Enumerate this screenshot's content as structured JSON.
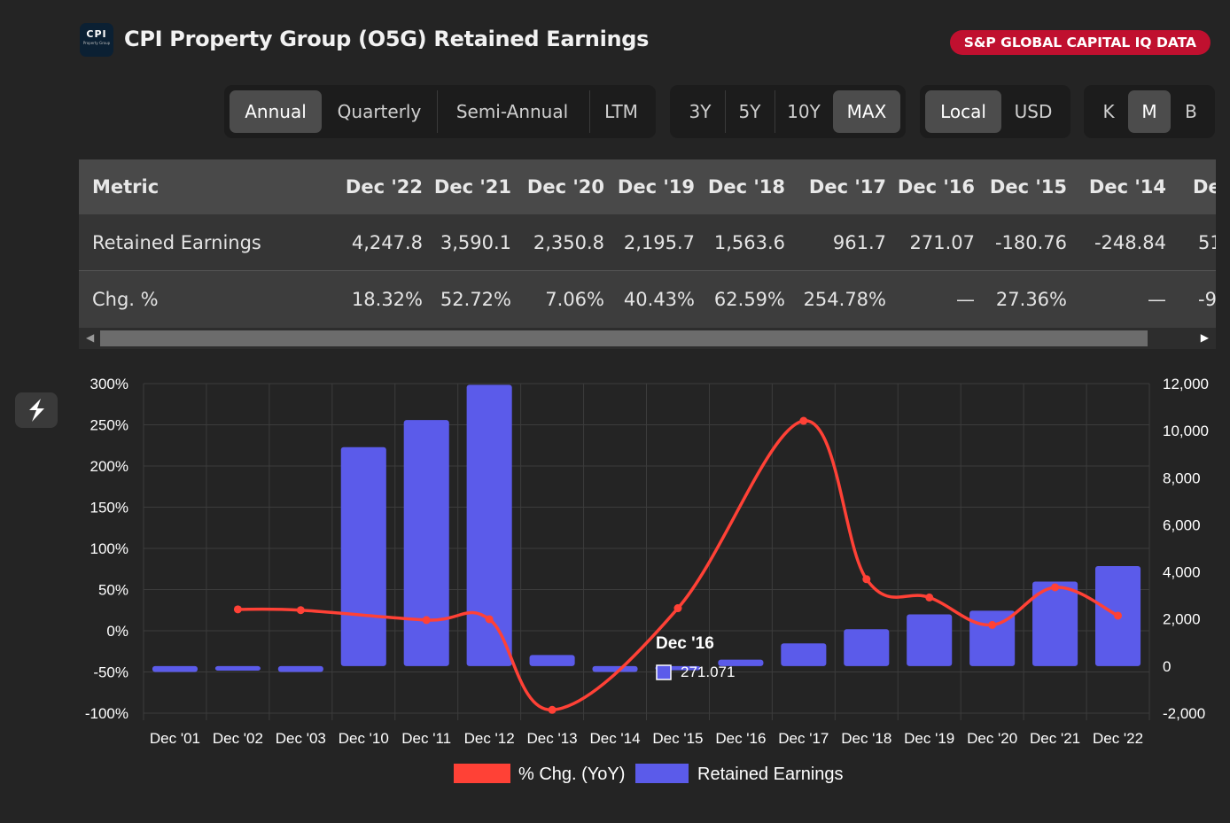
{
  "header": {
    "logo_text": "CPI",
    "logo_sub": "Property Group",
    "title": "CPI Property Group (O5G) Retained Earnings",
    "badge": "S&P GLOBAL CAPITAL IQ DATA"
  },
  "controls": {
    "period": [
      "Annual",
      "Quarterly",
      "Semi-Annual",
      "LTM"
    ],
    "period_active": "Annual",
    "range": [
      "3Y",
      "5Y",
      "10Y",
      "MAX"
    ],
    "range_active": "MAX",
    "currency": [
      "Local",
      "USD"
    ],
    "currency_active": "Local",
    "units": [
      "K",
      "M",
      "B"
    ],
    "units_active": "M"
  },
  "table": {
    "metric_header": "Metric",
    "columns": [
      "Dec '22",
      "Dec '21",
      "Dec '20",
      "Dec '19",
      "Dec '18",
      "Dec '17",
      "Dec '16",
      "Dec '15",
      "Dec '14",
      "De"
    ],
    "rows": [
      {
        "label": "Retained Earnings",
        "values": [
          "4,247.8",
          "3,590.1",
          "2,350.8",
          "2,195.7",
          "1,563.6",
          "961.7",
          "271.07",
          "-180.76",
          "-248.84",
          "51"
        ]
      },
      {
        "label": "Chg. %",
        "values": [
          "18.32%",
          "52.72%",
          "7.06%",
          "40.43%",
          "62.59%",
          "254.78%",
          "—",
          "27.36%",
          "—",
          "-9"
        ]
      }
    ]
  },
  "chart_data": {
    "type": "bar",
    "categories": [
      "Dec '01",
      "Dec '02",
      "Dec '03",
      "Dec '10",
      "Dec '11",
      "Dec '12",
      "Dec '13",
      "Dec '14",
      "Dec '15",
      "Dec '16",
      "Dec '17",
      "Dec '18",
      "Dec '19",
      "Dec '20",
      "Dec '21",
      "Dec '22"
    ],
    "series": [
      {
        "name": "Retained Earnings",
        "kind": "bar",
        "axis": "right",
        "color": "#5b5bea",
        "values": [
          -248,
          -195,
          -248,
          9300,
          10450,
          11950,
          470,
          -248.84,
          -180.76,
          271.07,
          961.7,
          1563.6,
          2195.7,
          2350.8,
          3590.1,
          4247.8
        ]
      },
      {
        "name": "% Chg. (YoY)",
        "kind": "line",
        "axis": "left",
        "color": "#ff4136",
        "values": [
          null,
          26,
          25,
          null,
          13,
          14,
          -96,
          null,
          27.36,
          null,
          254.78,
          62.59,
          40.43,
          7.06,
          52.72,
          18.32
        ]
      }
    ],
    "y_left": {
      "min": -100,
      "max": 300,
      "ticks": [
        "300%",
        "250%",
        "200%",
        "150%",
        "100%",
        "50%",
        "0%",
        "-50%",
        "-100%"
      ]
    },
    "y_right": {
      "min": -2000,
      "max": 12000,
      "ticks": [
        "12,000",
        "10,000",
        "8,000",
        "6,000",
        "4,000",
        "2,000",
        "0",
        "-2,000"
      ]
    },
    "legend": [
      "% Chg. (YoY)",
      "Retained Earnings"
    ],
    "legend_position": "bottom",
    "grid": true,
    "tooltip": {
      "title": "Dec '16",
      "value": "271.071"
    }
  }
}
